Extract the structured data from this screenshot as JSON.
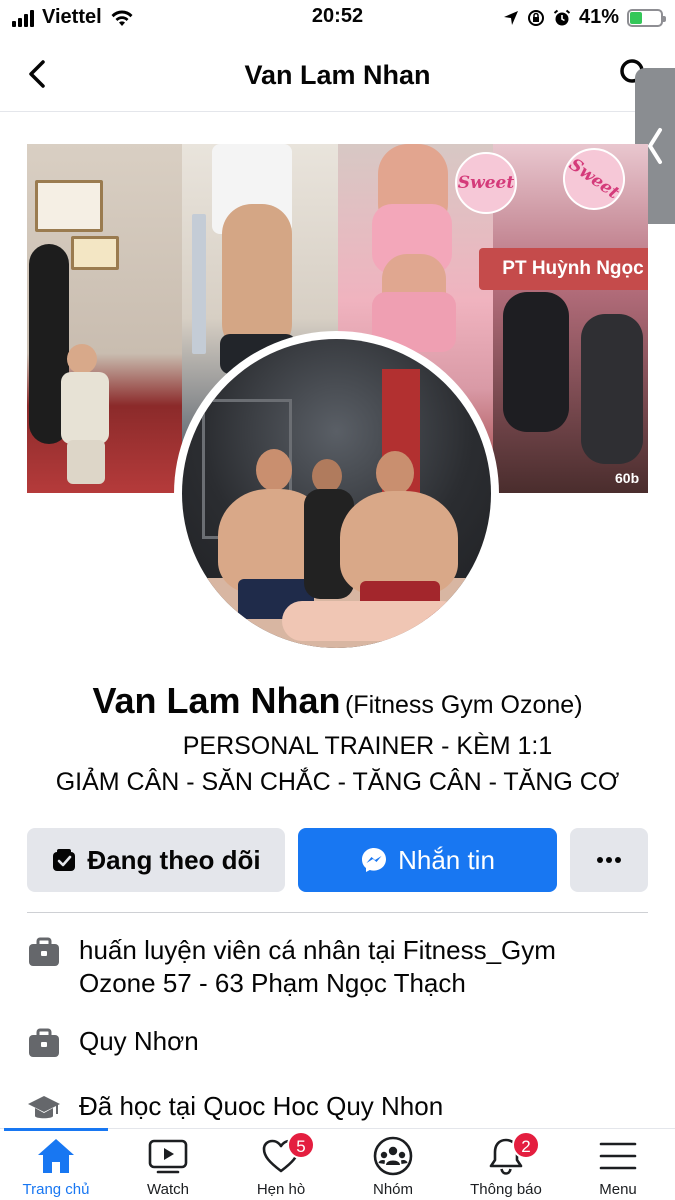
{
  "status_bar": {
    "carrier": "Viettel",
    "time": "20:52",
    "battery": "41%",
    "battery_level": 0.41
  },
  "header": {
    "title": "Van Lam Nhan"
  },
  "cover": {
    "caption": "PT Huỳnh Ngọc",
    "sweet_left": "Sweet",
    "sweet_right": "Sweet",
    "badge": "60b"
  },
  "profile": {
    "name": "Van Lam Nhan",
    "alt_name": "(Fitness Gym Ozone)",
    "bio_line1": "PERSONAL TRAINER - KÈM 1:1",
    "bio_line2": "GIẢM CÂN -  SĂN CHẮC - TĂNG CÂN - TĂNG CƠ"
  },
  "actions": {
    "follow_label": "Đang theo dõi",
    "message_label": "Nhắn tin",
    "more_label": "···"
  },
  "info": [
    {
      "icon": "briefcase-icon",
      "text": "huấn luyện viên cá nhân tại Fitness_Gym Ozone 57 - 63 Phạm Ngọc Thạch"
    },
    {
      "icon": "briefcase-icon",
      "text": "Quy Nhơn"
    },
    {
      "icon": "graduation-cap-icon",
      "text": "Đã học tại Quoc Hoc Quy Nhon"
    }
  ],
  "tabs": [
    {
      "label": "Trang chủ",
      "icon": "home-icon",
      "active": true
    },
    {
      "label": "Watch",
      "icon": "watch-video-icon"
    },
    {
      "label": "Hẹn hò",
      "icon": "heart-icon",
      "badge": "5"
    },
    {
      "label": "Nhóm",
      "icon": "groups-icon"
    },
    {
      "label": "Thông báo",
      "icon": "bell-icon",
      "badge": "2"
    },
    {
      "label": "Menu",
      "icon": "menu-icon"
    }
  ],
  "colors": {
    "accent": "#1877f2",
    "badge": "#e41e3f",
    "button_gray": "#e4e6eb"
  }
}
